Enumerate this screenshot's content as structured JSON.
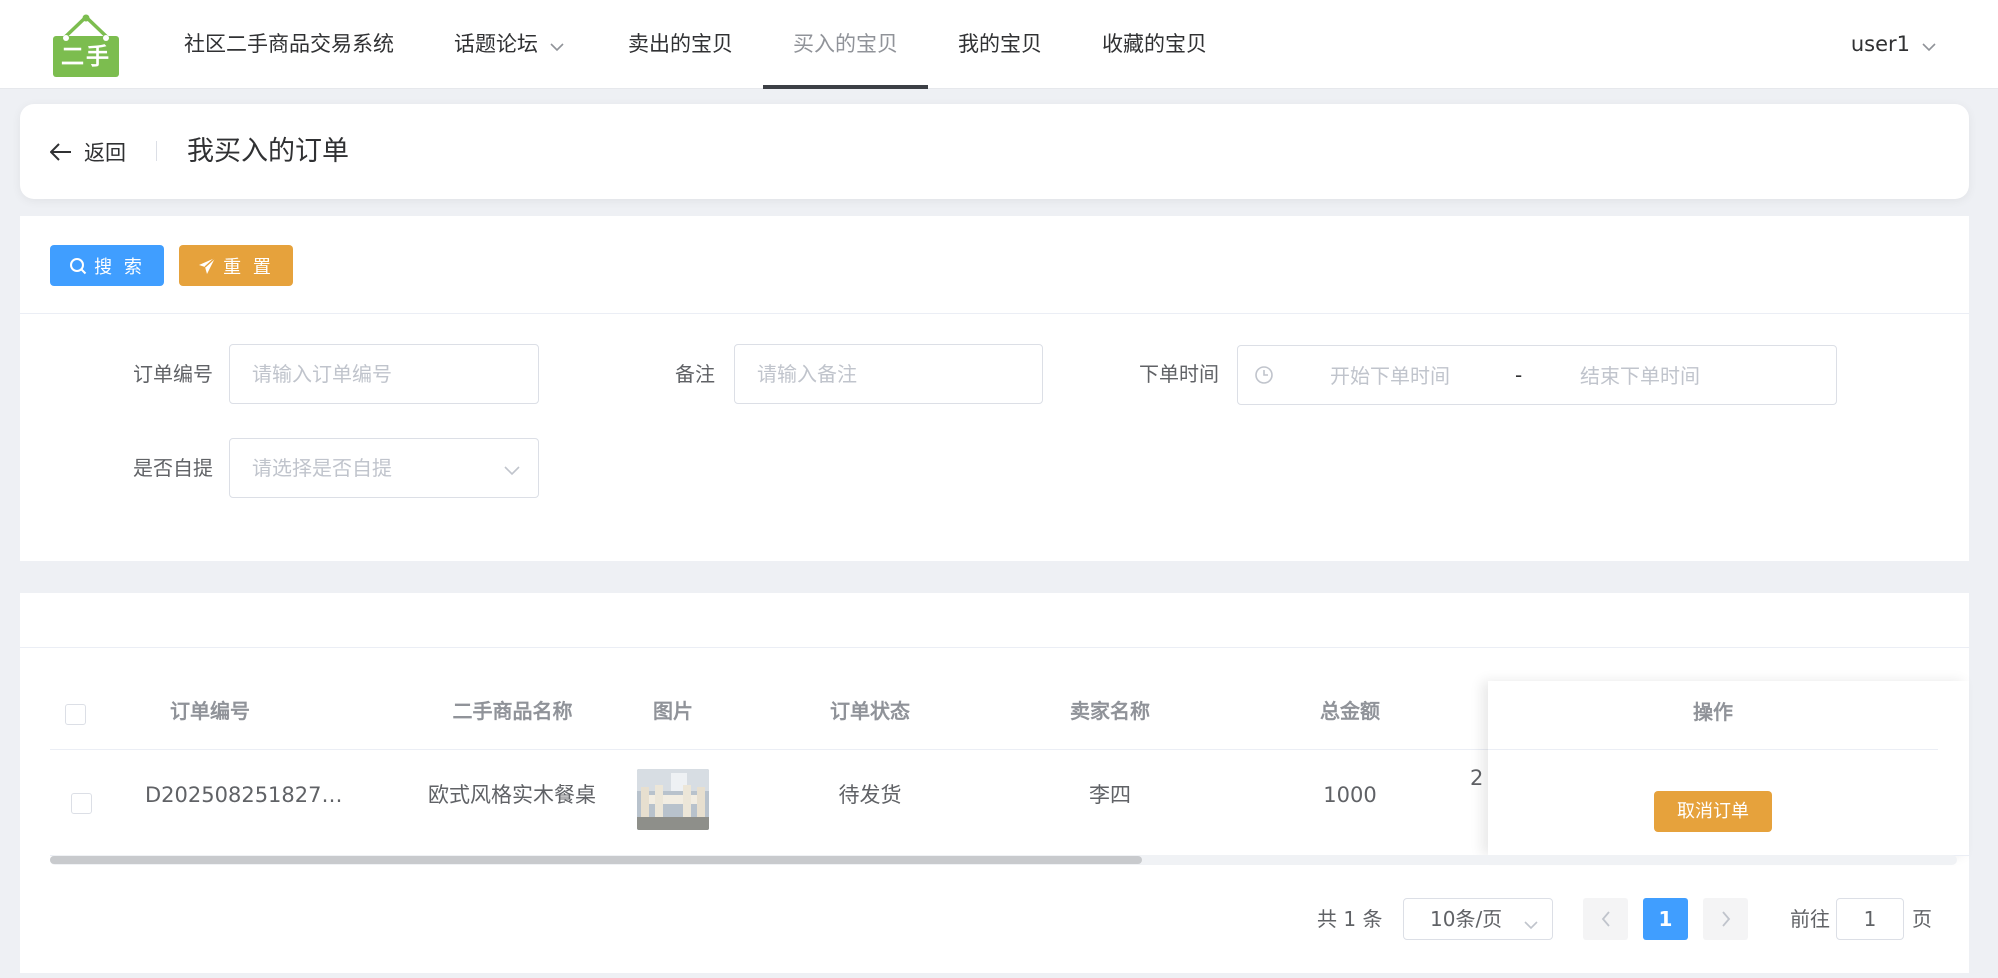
{
  "header": {
    "logo_text": "二手",
    "nav": [
      {
        "label": "社区二手商品交易系统"
      },
      {
        "label": "话题论坛"
      },
      {
        "label": "卖出的宝贝"
      },
      {
        "label": "买入的宝贝"
      },
      {
        "label": "我的宝贝"
      },
      {
        "label": "收藏的宝贝"
      }
    ],
    "user": "user1"
  },
  "title_bar": {
    "back": "返回",
    "title": "我买入的订单"
  },
  "actions": {
    "search": "搜 索",
    "reset": "重 置"
  },
  "filters": {
    "order_no": {
      "label": "订单编号",
      "placeholder": "请输入订单编号"
    },
    "remark": {
      "label": "备注",
      "placeholder": "请输入备注"
    },
    "order_time": {
      "label": "下单时间",
      "start_placeholder": "开始下单时间",
      "separator": "-",
      "end_placeholder": "结束下单时间"
    },
    "self_pickup": {
      "label": "是否自提",
      "placeholder": "请选择是否自提"
    }
  },
  "table": {
    "columns": [
      "订单编号",
      "二手商品名称",
      "图片",
      "订单状态",
      "卖家名称",
      "总金额"
    ],
    "action_column": "操作",
    "rows": [
      {
        "order_no": "D20250825182715...",
        "product": "欧式风格实木餐桌",
        "status": "待发货",
        "seller": "李四",
        "total": "1000",
        "partial": "2",
        "action": "取消订单"
      }
    ]
  },
  "pagination": {
    "total": "共 1 条",
    "page_size": "10条/页",
    "current": "1",
    "goto_label": "前往",
    "goto_value": "1",
    "page_suffix": "页"
  },
  "colors": {
    "primary": "#409eff",
    "warning": "#e6a23c",
    "logo_green": "#7cbd4f"
  }
}
